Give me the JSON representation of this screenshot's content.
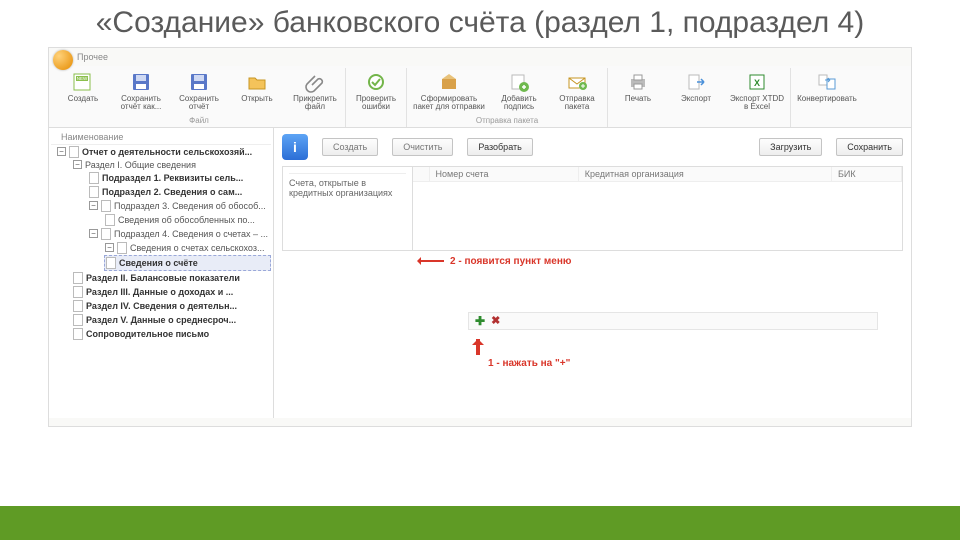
{
  "slide": {
    "title": "«Создание» банковского счёта (раздел 1, подраздел 4)"
  },
  "menubar": {
    "item1": "Прочее"
  },
  "ribbon": {
    "create": "Создать",
    "save_as": "Сохранить отчёт как...",
    "save": "Сохранить отчёт",
    "open": "Открыть",
    "attach": "Прикрепить файл",
    "check": "Проверить ошибки",
    "pack": "Сформировать пакет для отправки",
    "sign": "Добавить подпись",
    "send": "Отправка пакета",
    "print": "Печать",
    "export": "Экспорт",
    "export_xtdd": "Экспорт XTDD в Excel",
    "convert": "Конвертировать",
    "group_file": "Файл",
    "group_send": "Отправка пакета"
  },
  "tree": {
    "header": "Наименование",
    "items": [
      "Отчет о деятельности сельскохозяй...",
      "Раздел I. Общие сведения",
      "Подраздел 1. Реквизиты сель...",
      "Подраздел 2. Сведения о сам...",
      "Подраздел 3. Сведения об обособ...",
      "Сведения об обособленных по...",
      "Подраздел 4. Сведения о счетах – ...",
      "Сведения о счетах сельскохоз...",
      "Сведения о счёте",
      "Раздел II. Балансовые показатели",
      "Раздел III. Данные о доходах и ...",
      "Раздел IV. Сведения о деятельн...",
      "Раздел V. Данные о среднесроч...",
      "Сопроводительное письмо"
    ]
  },
  "content": {
    "btn_create": "Создать",
    "btn_clear": "Очистить",
    "btn_parse": "Разобрать",
    "btn_load": "Загрузить",
    "btn_save": "Сохранить",
    "left_header": "",
    "left_text": "Счета, открытые в кредитных организациях",
    "col_num": "Номер счета",
    "col_org": "Кредитная организация",
    "col_bik": "БИК"
  },
  "annot": {
    "a1": "1 - нажать на \"+\"",
    "a2": "2 - появится пункт меню"
  }
}
